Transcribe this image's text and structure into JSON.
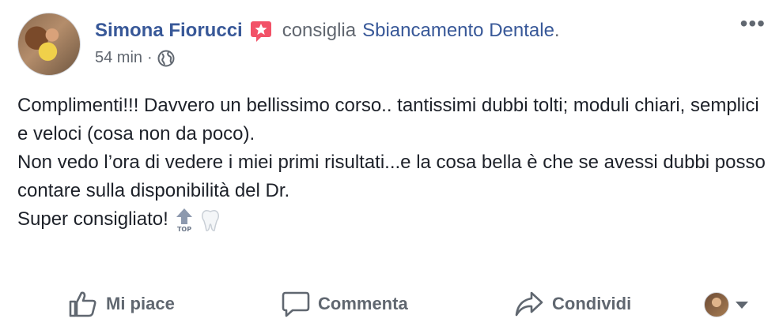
{
  "post": {
    "author": "Simona Fiorucci",
    "verb": "consiglia",
    "page": "Sbiancamento Dentale",
    "page_suffix": ".",
    "time": "54 min",
    "meta_separator": "·",
    "more_icon": "ellipsis-icon",
    "badge_icon": "recommend-star-icon",
    "privacy_icon": "globe-icon",
    "text_lines": [
      "Complimenti!!! Davvero un bellissimo corso.. tantissimi dubbi tolti; moduli chiari, semplici e veloci (cosa non da poco).",
      "Non vedo l’ora di vedere i miei primi risultati...e la cosa bella è che se avessi dubbi posso contare sulla disponibilità del Dr.",
      "Super consigliato!"
    ],
    "emojis": [
      "top-arrow-emoji",
      "tooth-emoji"
    ]
  },
  "actions": {
    "like": "Mi piace",
    "comment": "Commenta",
    "share": "Condividi"
  },
  "colors": {
    "link": "#385898",
    "secondary": "#616770",
    "badge": "#f25268"
  }
}
